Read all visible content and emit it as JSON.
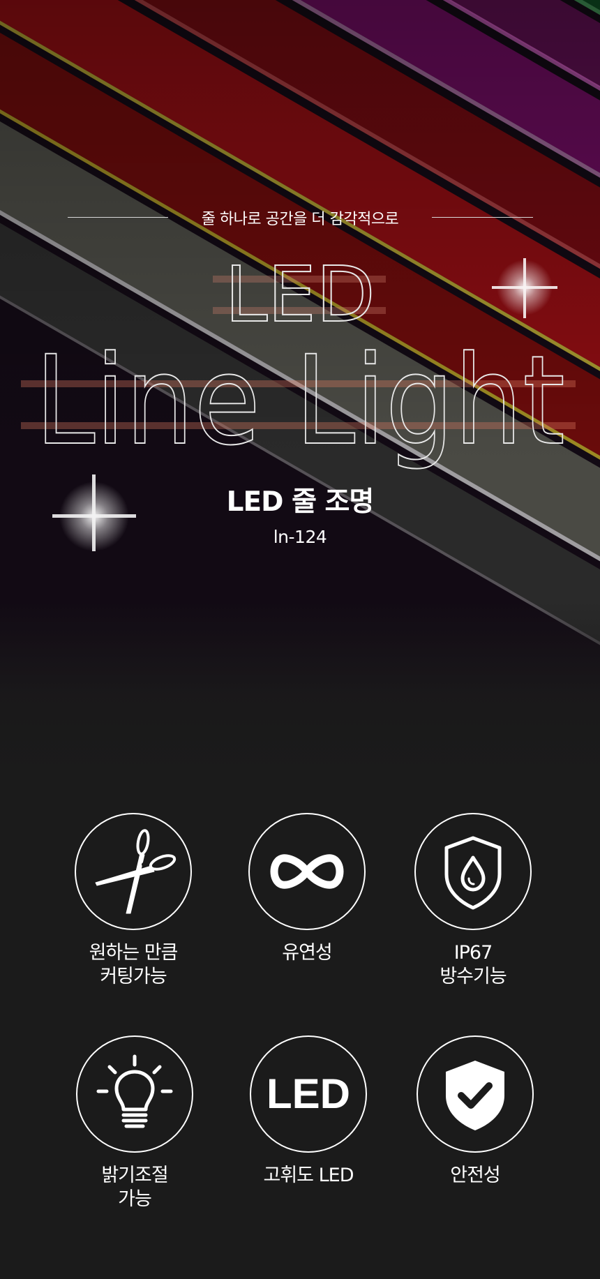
{
  "hero": {
    "tagline": "줄 하나로 공간을 더 감각적으로",
    "title_line1": "LED",
    "title_line2": "Line Light",
    "subtitle": "LED 줄 조명",
    "model": "ln-124"
  },
  "features": [
    {
      "icon": "scissors-icon",
      "label_line1": "원하는 만큼",
      "label_line2": "커팅가능"
    },
    {
      "icon": "infinity-icon",
      "label_line1": "유연성",
      "label_line2": ""
    },
    {
      "icon": "water-shield-icon",
      "label_line1": "IP67",
      "label_line2": "방수기능"
    },
    {
      "icon": "bulb-icon",
      "label_line1": "밝기조절",
      "label_line2": "가능"
    },
    {
      "icon": "led-text-icon",
      "icon_text": "LED",
      "label_line1": "고휘도 LED",
      "label_line2": ""
    },
    {
      "icon": "shield-check-icon",
      "label_line1": "안전성",
      "label_line2": ""
    }
  ],
  "colors": {
    "background": "#1b1b1b",
    "text": "#ffffff",
    "stripe_red": "#b0121e",
    "stripe_magenta": "#8c1a74",
    "stripe_green": "#1f8a3a",
    "stripe_blue": "#1a3fa0",
    "stripe_yellow": "#b9a41c",
    "stripe_white": "#c8c8c8"
  }
}
